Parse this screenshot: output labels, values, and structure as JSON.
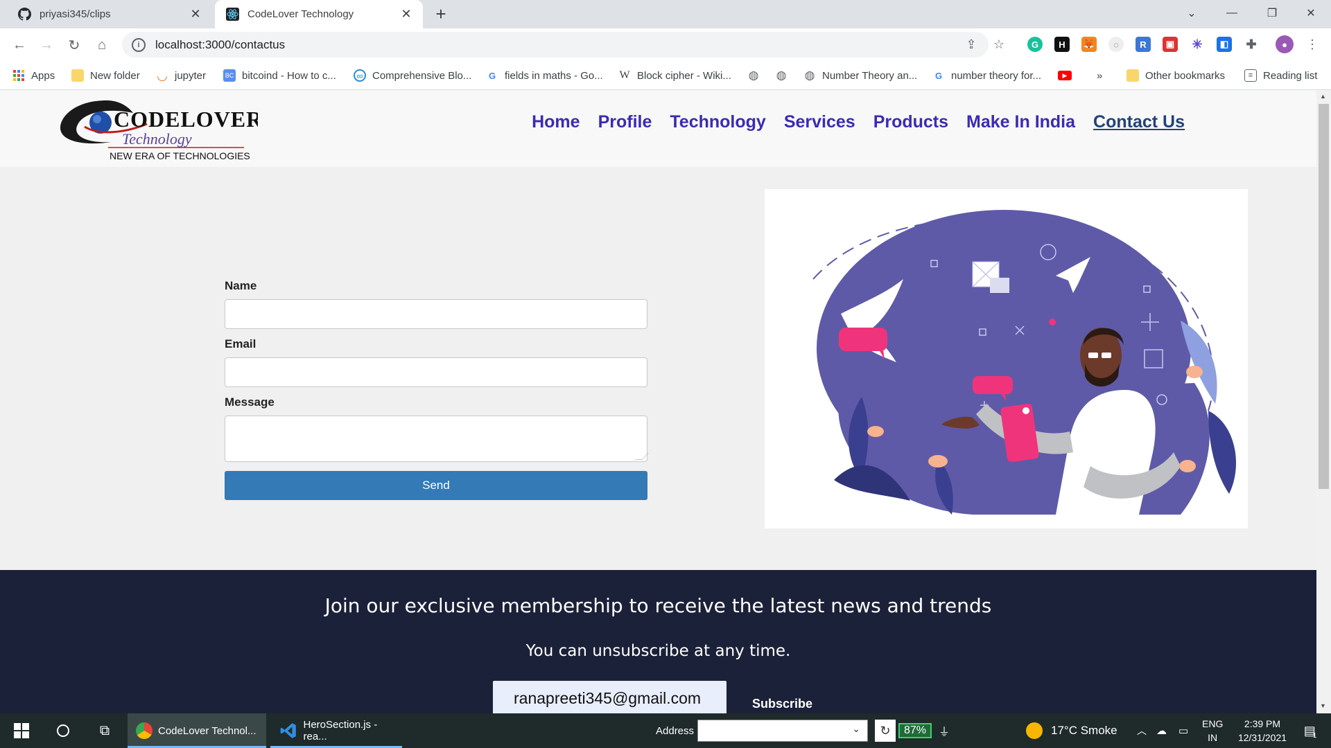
{
  "browser": {
    "tabs": [
      {
        "title": "priyasi345/clips",
        "icon": "github-icon",
        "active": false
      },
      {
        "title": "CodeLover Technology",
        "icon": "react-icon",
        "active": true
      }
    ],
    "new_tab": "+",
    "url": "localhost:3000/contactus",
    "bookmarks": [
      {
        "label": "Apps",
        "icon": "apps-grid-icon"
      },
      {
        "label": "New folder",
        "icon": "folder-icon"
      },
      {
        "label": "jupyter",
        "icon": "jupyter-icon"
      },
      {
        "label": "bitcoind - How to c...",
        "icon": "bookmark-icon"
      },
      {
        "label": "Comprehensive Blo...",
        "icon": "bookmark-icon"
      },
      {
        "label": "fields in maths - Go...",
        "icon": "google-icon"
      },
      {
        "label": "Block cipher - Wiki...",
        "icon": "wikipedia-icon"
      },
      {
        "label": "",
        "icon": "globe-icon"
      },
      {
        "label": "",
        "icon": "globe-icon"
      },
      {
        "label": "Number Theory an...",
        "icon": "globe-icon"
      },
      {
        "label": "number theory for...",
        "icon": "google-icon"
      },
      {
        "label": "",
        "icon": "youtube-icon"
      }
    ],
    "more": "»",
    "other_bookmarks": "Other bookmarks",
    "reading_list": "Reading list"
  },
  "site": {
    "logo": {
      "brand": "CODELOVER",
      "sub": "Technology",
      "tagline": "NEW ERA OF TECHNOLOGIES"
    },
    "nav": [
      "Home",
      "Profile",
      "Technology",
      "Services",
      "Products",
      "Make In India",
      "Contact Us"
    ],
    "form": {
      "name_label": "Name",
      "email_label": "Email",
      "message_label": "Message",
      "send_label": "Send"
    },
    "footer": {
      "headline": "Join our exclusive membership to receive the latest news and trends",
      "subtext": "You can unsubscribe at any time.",
      "email_value": "ranapreeti345@gmail.com",
      "subscribe_label": "Subscribe"
    }
  },
  "taskbar": {
    "apps": [
      {
        "label": "CodeLover Technol...",
        "icon": "chrome-icon"
      },
      {
        "label": "HeroSection.js - rea...",
        "icon": "vscode-icon"
      }
    ],
    "address_label": "Address",
    "battery": "87%",
    "weather": "17°C  Smoke",
    "lang": "ENG",
    "region": "IN",
    "time": "2:39 PM",
    "date": "12/31/2021",
    "notifications": "1"
  },
  "colors": {
    "nav_link": "#3a2bb5",
    "send_button": "#337ab7",
    "footer_bg": "#1b2138"
  }
}
